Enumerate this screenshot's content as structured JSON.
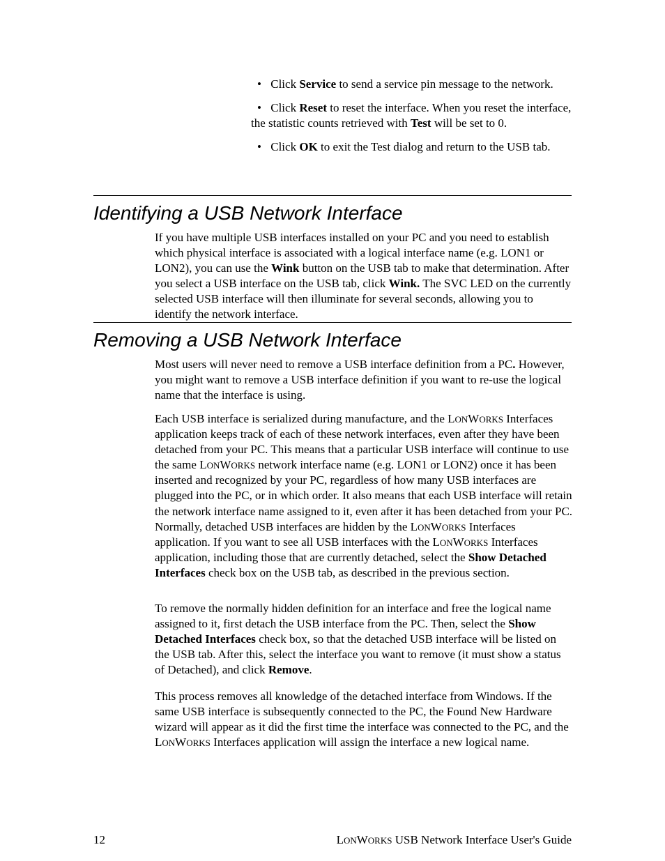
{
  "bullets": {
    "b1_pre": "Click ",
    "b1_bold": "Service",
    "b1_post": " to send a service pin message to the network.",
    "b2_pre": "Click ",
    "b2_bold": "Reset",
    "b2_mid": " to reset the interface.  When you reset the interface, the statistic counts retrieved with ",
    "b2_bold2": "Test",
    "b2_post": " will be set to 0.",
    "b3_pre": "Click ",
    "b3_bold": "OK",
    "b3_post": " to exit the Test dialog and return to the USB tab."
  },
  "headings": {
    "h1": "Identifying a USB Network Interface",
    "h2": "Removing a USB Network Interface"
  },
  "identify": {
    "p1a": "If you have multiple USB interfaces installed on your PC and you need to establish which physical interface is associated with a logical interface name (e.g. LON1 or LON2), you can use the ",
    "p1b": "Wink",
    "p1c": " button on the USB tab to make that determination.  After you select a USB interface on the USB tab, click ",
    "p1d": "Wink.",
    "p1e": "  The SVC LED on the currently selected USB interface will then illuminate for several seconds, allowing you to identify the network interface."
  },
  "remove": {
    "p1a": "Most users will never need to remove a USB interface definition from a PC",
    "p1b": ".",
    "p1c": "  However, you might want to remove a USB interface definition if you want to re-use the logical name that the interface is using.",
    "p2a": "Each USB interface is serialized during manufacture, and the L",
    "p2b": "ON",
    "p2c": "W",
    "p2d": "ORKS",
    "p2e": " Interfaces application keeps track of each of these network interfaces, even after they have been detached from your PC.  This means that a particular USB interface will continue to use the same L",
    "p2f": "ON",
    "p2g": "W",
    "p2h": "ORKS",
    "p2i": " network interface name (e.g. LON1 or LON2) once it has been inserted and recognized by your PC, regardless of how many USB interfaces are plugged into the PC, or in which order.  It also means that each USB interface will retain the network interface name assigned to it, even after it has been detached from your PC.  Normally, detached USB interfaces are hidden by the L",
    "p2j": "ON",
    "p2k": "W",
    "p2l": "ORKS",
    "p2m": " Interfaces application.  If you want to see all USB interfaces with the L",
    "p2n": "ON",
    "p2o": "W",
    "p2p": "ORKS",
    "p2q": " Interfaces application, including those that are currently detached, select the ",
    "p2r": "Show Detached Interfaces",
    "p2s": " check box on the USB tab, as described in the previous section.",
    "p3a": "To remove the normally hidden definition for an interface and free the logical name assigned to it, first detach the USB interface from the PC.  Then, select the ",
    "p3b": "Show Detached Interfaces",
    "p3c": " check box, so that the detached USB interface will be listed on the USB tab.  After this, select the interface you want to remove (it must show a status of Detached), and click ",
    "p3d": "Remove",
    "p3e": ".",
    "p4a": "This process removes all knowledge of the detached interface from Windows.  If the same USB interface is subsequently connected to the PC, the Found New Hardware wizard will appear as it did the first time the interface was connected to the PC, and the L",
    "p4b": "ON",
    "p4c": "W",
    "p4d": "ORKS",
    "p4e": " Interfaces application will assign the interface a new logical name."
  },
  "footer": {
    "page": "12",
    "title_pre": "L",
    "title_sc1": "ON",
    "title_mid": "W",
    "title_sc2": "ORKS",
    "title_post": " USB Network Interface User's Guide"
  }
}
